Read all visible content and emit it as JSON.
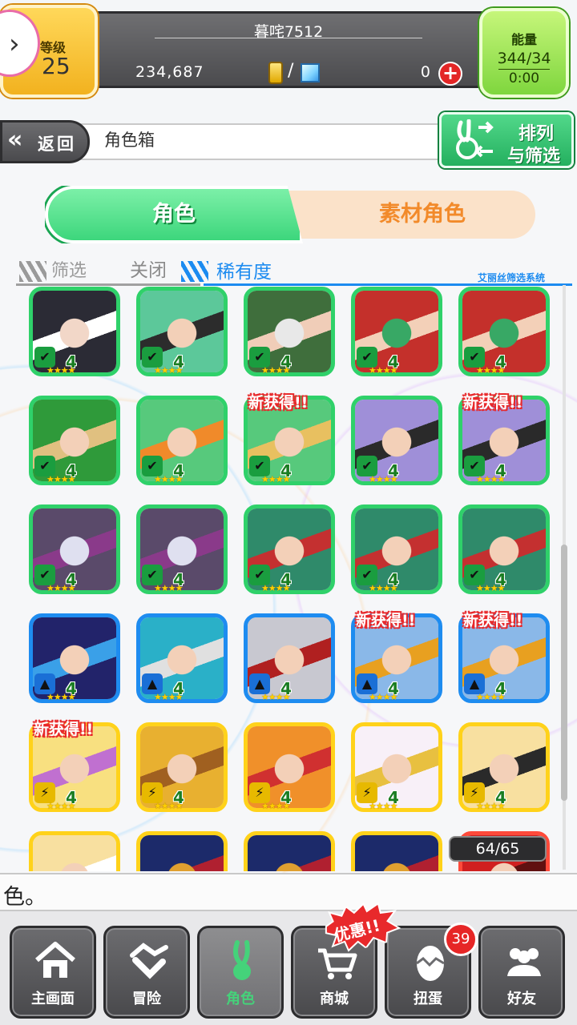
{
  "status": {
    "level_label": "等级",
    "level_value": "25",
    "player_name": "暮咤7512",
    "gold": "234,687",
    "gems": "0",
    "energy_label": "能量",
    "energy_value": "344/34",
    "energy_timer": "0:00"
  },
  "header": {
    "back_label": "返回",
    "title": "角色箱",
    "sort_line1": "排列",
    "sort_line2": "与筛选"
  },
  "tabs": {
    "character": "角色",
    "material": "素材角色"
  },
  "filter": {
    "filter_label": "筛选",
    "off_label": "关闭",
    "rarity_label": "稀有度",
    "system_label": "艾丽丝筛选系统"
  },
  "cards": [
    {
      "element": "wind",
      "level": "4",
      "new": false,
      "palette": [
        "#2b2b35",
        "#f2d7c8",
        "#ffffff"
      ]
    },
    {
      "element": "wind",
      "level": "4",
      "new": false,
      "palette": [
        "#5cc89a",
        "#f3d0b8",
        "#2c2c2c"
      ]
    },
    {
      "element": "wind",
      "level": "4",
      "new": false,
      "palette": [
        "#3f6e3c",
        "#e8e8e8",
        "#f0cdb8"
      ]
    },
    {
      "element": "wind",
      "level": "4",
      "new": false,
      "palette": [
        "#c4302b",
        "#38a865",
        "#f3d0b8"
      ]
    },
    {
      "element": "wind",
      "level": "4",
      "new": false,
      "palette": [
        "#c4302b",
        "#38a865",
        "#f3d0b8"
      ]
    },
    {
      "element": "wind",
      "level": "4",
      "new": false,
      "palette": [
        "#2f9a3a",
        "#f3d0b8",
        "#e0c080"
      ]
    },
    {
      "element": "wind",
      "level": "4",
      "new": false,
      "palette": [
        "#57c97c",
        "#f3d0b8",
        "#f08a2a"
      ]
    },
    {
      "element": "wind",
      "level": "4",
      "new": true,
      "palette": [
        "#57c97c",
        "#f3d0b8",
        "#e8c060"
      ]
    },
    {
      "element": "wind",
      "level": "4",
      "new": false,
      "palette": [
        "#9f8fd8",
        "#f3d0b8",
        "#2a2a2a"
      ]
    },
    {
      "element": "wind",
      "level": "4",
      "new": true,
      "palette": [
        "#9f8fd8",
        "#f3d0b8",
        "#2a2a2a"
      ]
    },
    {
      "element": "wind",
      "level": "4",
      "new": false,
      "palette": [
        "#5a4a6a",
        "#dfe0f0",
        "#8a3a8a"
      ]
    },
    {
      "element": "wind",
      "level": "4",
      "new": false,
      "palette": [
        "#5a4a6a",
        "#dfe0f0",
        "#8a3a8a"
      ]
    },
    {
      "element": "wind",
      "level": "4",
      "new": false,
      "palette": [
        "#2f8a6a",
        "#f3d0b8",
        "#c43030"
      ]
    },
    {
      "element": "wind",
      "level": "4",
      "new": false,
      "palette": [
        "#2f8a6a",
        "#f3d0b8",
        "#c43030"
      ]
    },
    {
      "element": "wind",
      "level": "4",
      "new": false,
      "palette": [
        "#2f8a6a",
        "#f3d0b8",
        "#c43030"
      ]
    },
    {
      "element": "water",
      "level": "4",
      "new": false,
      "palette": [
        "#22236a",
        "#f3d0b8",
        "#3aa0e8"
      ]
    },
    {
      "element": "water",
      "level": "4",
      "new": false,
      "palette": [
        "#2ab0c8",
        "#f3d0b8",
        "#e0e0e0"
      ]
    },
    {
      "element": "water",
      "level": "4",
      "new": false,
      "palette": [
        "#c8c8d0",
        "#f3d0b8",
        "#b02020"
      ]
    },
    {
      "element": "water",
      "level": "4",
      "new": true,
      "palette": [
        "#8ab8e8",
        "#f3d0b8",
        "#e8a020"
      ]
    },
    {
      "element": "water",
      "level": "4",
      "new": true,
      "palette": [
        "#8ab8e8",
        "#f3d0b8",
        "#e8a020"
      ]
    },
    {
      "element": "thunder",
      "level": "4",
      "new": true,
      "palette": [
        "#f8e080",
        "#f3d0b8",
        "#c070d0"
      ]
    },
    {
      "element": "thunder",
      "level": "4",
      "new": false,
      "palette": [
        "#e8b030",
        "#f3d0b8",
        "#a06020"
      ]
    },
    {
      "element": "thunder",
      "level": "4",
      "new": false,
      "palette": [
        "#f0902a",
        "#f3d0b8",
        "#d03030"
      ]
    },
    {
      "element": "thunder",
      "level": "4",
      "new": false,
      "palette": [
        "#f8f0f8",
        "#f3d0b8",
        "#e8c040"
      ]
    },
    {
      "element": "thunder",
      "level": "4",
      "new": false,
      "palette": [
        "#f8e0a0",
        "#f3d0b8",
        "#2a2a2a"
      ]
    },
    {
      "element": "thunder",
      "level": "",
      "new": false,
      "palette": [
        "#f8e0a0",
        "#f3d0b8",
        "#ffffff"
      ]
    },
    {
      "element": "thunder",
      "level": "",
      "new": false,
      "palette": [
        "#1c2a6a",
        "#e0a030",
        "#b02030"
      ]
    },
    {
      "element": "thunder",
      "level": "",
      "new": false,
      "palette": [
        "#1c2a6a",
        "#e0a030",
        "#b02030"
      ]
    },
    {
      "element": "thunder",
      "level": "",
      "new": false,
      "palette": [
        "#1c2a6a",
        "#e0a030",
        "#b02030"
      ]
    },
    {
      "element": "fire",
      "level": "",
      "new": false,
      "palette": [
        "#d02020",
        "#f3d0b8",
        "#601010"
      ]
    }
  ],
  "card_text": {
    "new_label": "新获得!!",
    "stars": "★★★★"
  },
  "count": "64/65",
  "message": "色。",
  "nav": {
    "home": "主画面",
    "adventure": "冒险",
    "character": "角色",
    "shop": "商城",
    "gacha": "扭蛋",
    "friends": "好友",
    "promo": "优惠!!",
    "gacha_badge": "39"
  },
  "colors": {
    "wind": "#2fd16a",
    "water": "#1e8cf0",
    "thunder": "#ffd21a",
    "fire": "#ff4a3a"
  }
}
